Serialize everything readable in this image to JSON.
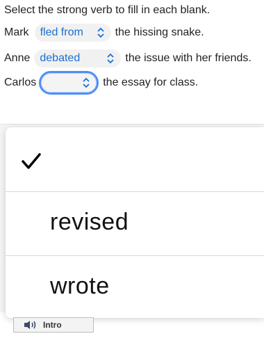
{
  "instruction": "Select the strong verb to fill in each blank.",
  "sentences": [
    {
      "subject": "Mark",
      "selected": "fled from",
      "rest": "the hissing snake."
    },
    {
      "subject": "Anne",
      "selected": "debated",
      "rest": "the issue with her friends."
    },
    {
      "subject": "Carlos",
      "selected": "",
      "rest": "the essay for class."
    }
  ],
  "dropdown": {
    "options": [
      "",
      "revised",
      "wrote"
    ],
    "checked_index": 0
  },
  "intro_button": {
    "label": "Intro"
  },
  "colors": {
    "accent": "#1a6fd0",
    "focus_ring": "#4f8ff7"
  },
  "icons": [
    "chevron-updown-icon",
    "checkmark-icon",
    "speaker-icon"
  ]
}
